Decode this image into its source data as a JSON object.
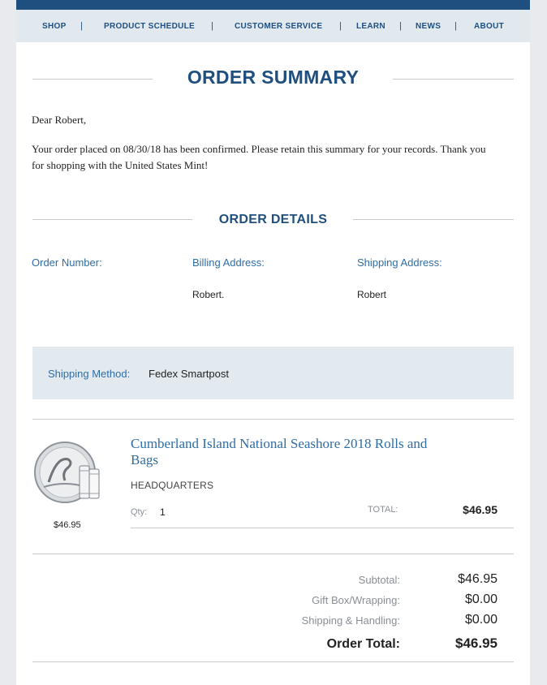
{
  "nav": {
    "items": [
      "SHOP",
      "PRODUCT SCHEDULE",
      "CUSTOMER SERVICE",
      "LEARN",
      "NEWS",
      "ABOUT"
    ]
  },
  "summary": {
    "title": "ORDER SUMMARY",
    "greeting": "Dear Robert,",
    "message": "Your order placed on 08/30/18 has been confirmed. Please retain this summary for your records. Thank you for shopping with the United States Mint!"
  },
  "details": {
    "title": "ORDER DETAILS",
    "order_number_label": "Order Number:",
    "billing_label": "Billing Address:",
    "billing_name": "Robert.",
    "shipping_label": "Shipping Address:",
    "shipping_name": "Robert",
    "shipping_method_label": "Shipping Method:",
    "shipping_method_value": "Fedex Smartpost"
  },
  "item": {
    "title": "Cumberland Island National Seashore 2018 Rolls and Bags",
    "sku": "HEADQUARTERS",
    "qty_label": "Qty:",
    "qty": "1",
    "total_label": "TOTAL:",
    "total": "$46.95",
    "unit_price": "$46.95",
    "image_icon": "coin-and-rolls-image"
  },
  "totals": {
    "subtotal_label": "Subtotal:",
    "subtotal": "$46.95",
    "gift_label": "Gift Box/Wrapping:",
    "gift": "$0.00",
    "shipping_label": "Shipping & Handling:",
    "shipping": "$0.00",
    "order_total_label": "Order Total:",
    "order_total": "$46.95"
  },
  "colors": {
    "brand": "#1f4f7f",
    "link": "#2e6da4",
    "panel": "#e3eaef"
  }
}
